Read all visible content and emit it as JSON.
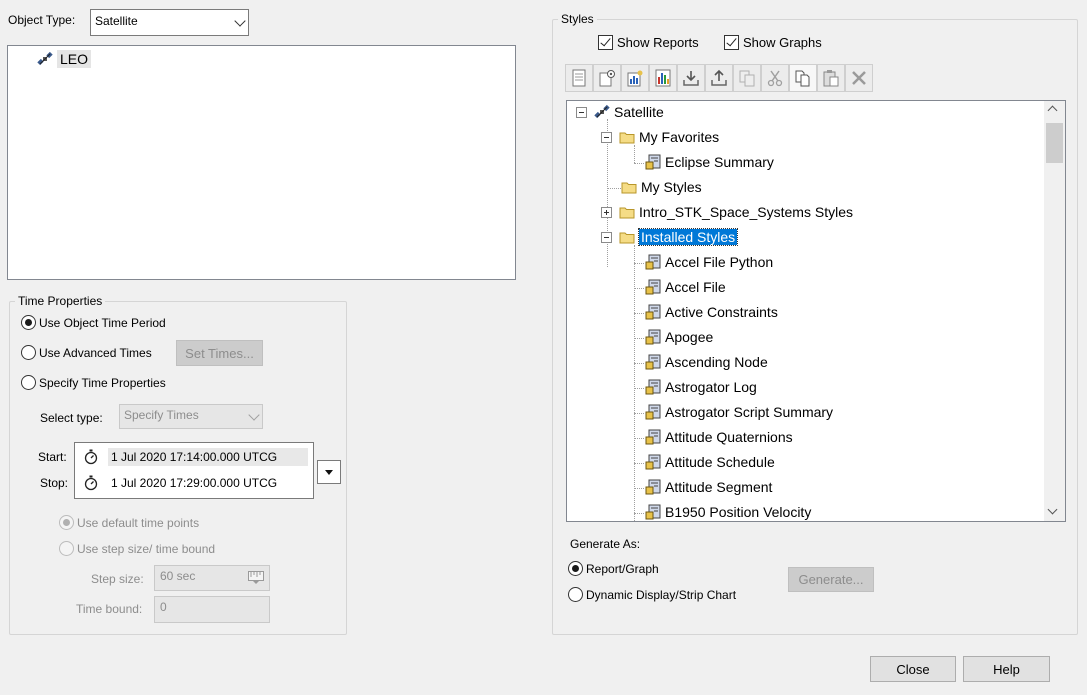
{
  "object_type": {
    "label": "Object Type:",
    "value": "Satellite"
  },
  "object_list": {
    "items": [
      "LEO"
    ]
  },
  "time_properties": {
    "title": "Time Properties",
    "use_object_time_period": "Use Object Time Period",
    "use_advanced_times": "Use Advanced Times",
    "set_times_button": "Set Times...",
    "specify_time_properties": "Specify Time Properties",
    "select_type_label": "Select type:",
    "select_type_value": "Specify Times",
    "start_label": "Start:",
    "start_value": "1 Jul 2020 17:14:00.000 UTCG",
    "stop_label": "Stop:",
    "stop_value": "1 Jul 2020 17:29:00.000 UTCG",
    "use_default_time_points": "Use default time points",
    "use_step_size": "Use step size/ time bound",
    "step_size_label": "Step size:",
    "step_size_value": "60 sec",
    "time_bound_label": "Time bound:",
    "time_bound_value": "0"
  },
  "styles": {
    "title": "Styles",
    "show_reports": "Show Reports",
    "show_graphs": "Show Graphs",
    "toolbar_icons": [
      "new-report-icon",
      "properties-icon",
      "new-graph-icon",
      "new-chart-icon",
      "import-icon",
      "export-icon",
      "copy-disabled-icon",
      "cut-icon",
      "copy-icon",
      "paste-icon",
      "delete-icon"
    ],
    "tree": {
      "root": "Satellite",
      "my_favorites": "My Favorites",
      "eclipse_summary": "Eclipse Summary",
      "my_styles": "My Styles",
      "intro_styles": "Intro_STK_Space_Systems Styles",
      "installed_styles": "Installed Styles",
      "installed_items": [
        "Accel File Python",
        "Accel File",
        "Active Constraints",
        "Apogee",
        "Ascending Node",
        "Astrogator Log",
        "Astrogator Script Summary",
        "Attitude Quaternions",
        "Attitude Schedule",
        "Attitude Segment",
        "B1950 Position Velocity"
      ]
    }
  },
  "generate_as": {
    "label": "Generate As:",
    "report_graph": "Report/Graph",
    "dynamic_display": "Dynamic Display/Strip Chart",
    "generate_button": "Generate..."
  },
  "footer": {
    "close_button": "Close",
    "help_button": "Help"
  },
  "colors": {
    "selection": "#0078d7",
    "folder": "#e8c24a",
    "background": "#f0f0f0"
  }
}
